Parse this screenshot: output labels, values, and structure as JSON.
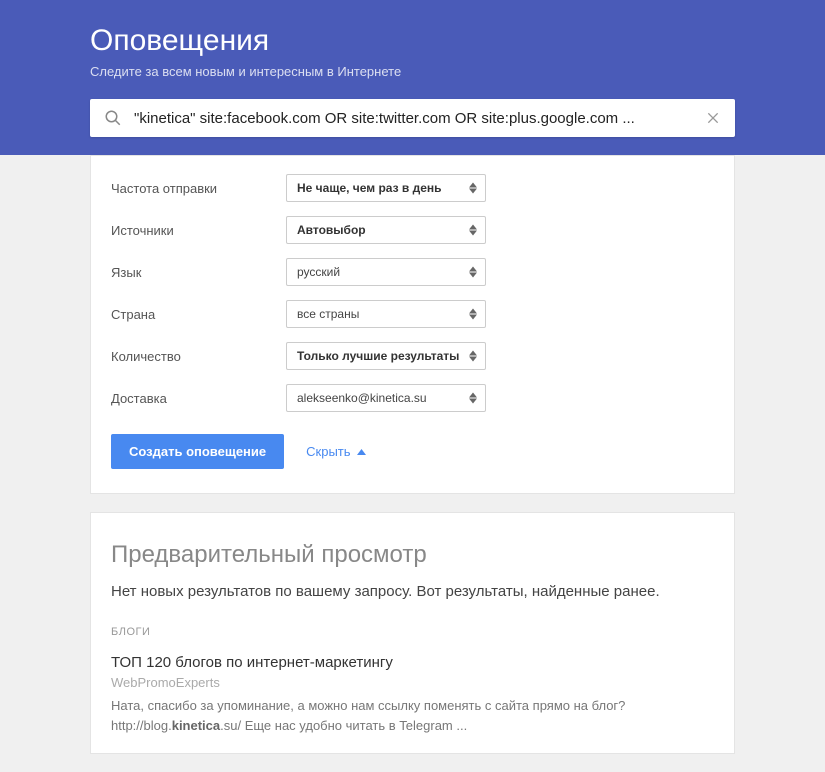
{
  "header": {
    "title": "Оповещения",
    "subtitle": "Следите за всем новым и интересным в Интернете"
  },
  "search": {
    "value": "\"kinetica\" site:facebook.com OR site:twitter.com OR site:plus.google.com ..."
  },
  "options": {
    "frequency": {
      "label": "Частота отправки",
      "value": "Не чаще, чем раз в день"
    },
    "sources": {
      "label": "Источники",
      "value": "Автовыбор"
    },
    "language": {
      "label": "Язык",
      "value": "русский"
    },
    "region": {
      "label": "Страна",
      "value": "все страны"
    },
    "howMany": {
      "label": "Количество",
      "value": "Только лучшие результаты"
    },
    "deliver": {
      "label": "Доставка",
      "value": "alekseenko@kinetica.su"
    }
  },
  "actions": {
    "create": "Создать оповещение",
    "hide": "Скрыть"
  },
  "preview": {
    "title": "Предварительный просмотр",
    "desc": "Нет новых результатов по вашему запросу. Вот результаты, найденные ранее.",
    "section": "БЛОГИ",
    "result": {
      "title": "ТОП 120 блогов по интернет-маркетингу",
      "source": "WebPromoExperts",
      "snippet_a": "Ната, спасибо за упоминание, а можно нам ссылку поменять с сайта прямо на блог? http://blog.",
      "snippet_b": "kinetica",
      "snippet_c": ".su/ Еще нас удобно читать в Telegram ..."
    }
  }
}
